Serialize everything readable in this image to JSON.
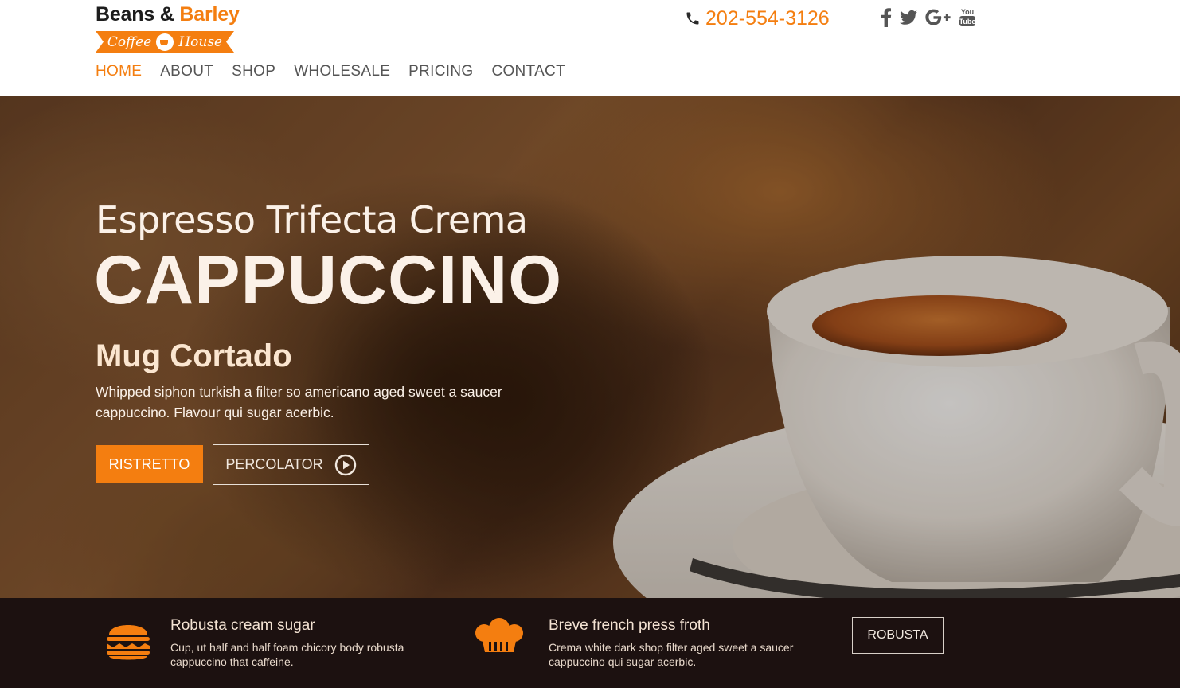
{
  "brand": {
    "name_part1": "Beans",
    "ampersand": " & ",
    "name_part2": "Barley",
    "sub_left": "Coffee",
    "sub_right": "House",
    "accent_color": "#f47e10"
  },
  "contact": {
    "phone_icon": "phone-icon",
    "phone": "202-554-3126"
  },
  "socials": [
    {
      "name": "facebook",
      "icon": "facebook-icon"
    },
    {
      "name": "twitter",
      "icon": "twitter-icon"
    },
    {
      "name": "google-plus",
      "icon": "google-plus-icon"
    },
    {
      "name": "youtube",
      "icon": "youtube-icon"
    }
  ],
  "nav": {
    "items": [
      {
        "label": "HOME",
        "active": true
      },
      {
        "label": "ABOUT",
        "active": false
      },
      {
        "label": "SHOP",
        "active": false
      },
      {
        "label": "WHOLESALE",
        "active": false
      },
      {
        "label": "PRICING",
        "active": false
      },
      {
        "label": "CONTACT",
        "active": false
      }
    ]
  },
  "hero": {
    "kicker": "Espresso Trifecta Crema",
    "title": "CAPPUCCINO",
    "subtitle": "Mug Cortado",
    "description": "Whipped siphon turkish a filter so americano aged sweet a saucer cappuccino. Flavour qui sugar acerbic.",
    "primary_button": "RISTRETTO",
    "secondary_button": "PERCOLATOR",
    "secondary_button_icon": "play-circle-icon"
  },
  "features": [
    {
      "icon": "burger-icon",
      "title": "Robusta cream sugar",
      "description": "Cup, ut half and half foam chicory body robusta cappuccino that caffeine."
    },
    {
      "icon": "chef-hat-icon",
      "title": "Breve french press froth",
      "description": "Crema white dark shop filter aged sweet a saucer cappuccino qui sugar acerbic."
    }
  ],
  "strip_button": "ROBUSTA"
}
